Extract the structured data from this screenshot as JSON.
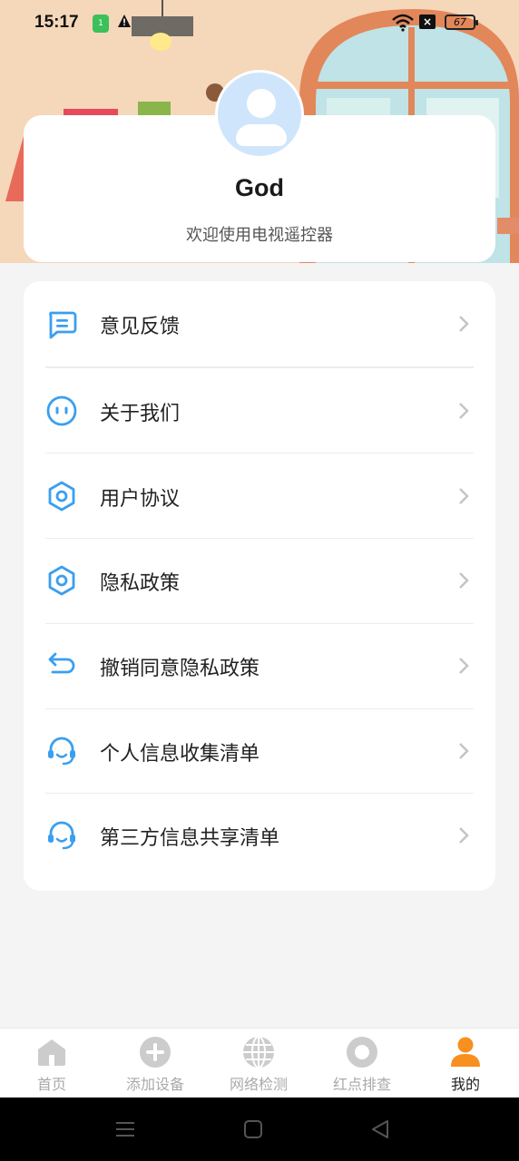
{
  "status_bar": {
    "time": "15:17",
    "sim_label": "1",
    "battery": "67"
  },
  "profile": {
    "username": "God",
    "welcome": "欢迎使用电视遥控器"
  },
  "menu": {
    "items": [
      {
        "label": "意见反馈",
        "icon": "feedback-chat-icon"
      },
      {
        "label": "关于我们",
        "icon": "about-smile-icon"
      },
      {
        "label": "用户协议",
        "icon": "hexagon-icon"
      },
      {
        "label": "隐私政策",
        "icon": "hexagon-icon"
      },
      {
        "label": "撤销同意隐私政策",
        "icon": "undo-arrow-icon"
      },
      {
        "label": "个人信息收集清单",
        "icon": "headset-icon"
      },
      {
        "label": "第三方信息共享清单",
        "icon": "headset-icon"
      }
    ]
  },
  "tabbar": {
    "tabs": [
      {
        "label": "首页",
        "icon": "home-icon"
      },
      {
        "label": "添加设备",
        "icon": "add-circle-icon"
      },
      {
        "label": "网络检测",
        "icon": "globe-icon"
      },
      {
        "label": "红点排查",
        "icon": "ring-icon"
      },
      {
        "label": "我的",
        "icon": "person-icon",
        "active": true
      }
    ]
  },
  "colors": {
    "accent_blue": "#3a9ff0",
    "active_tab": "#f7901e",
    "inactive_tab": "#cccccc"
  }
}
